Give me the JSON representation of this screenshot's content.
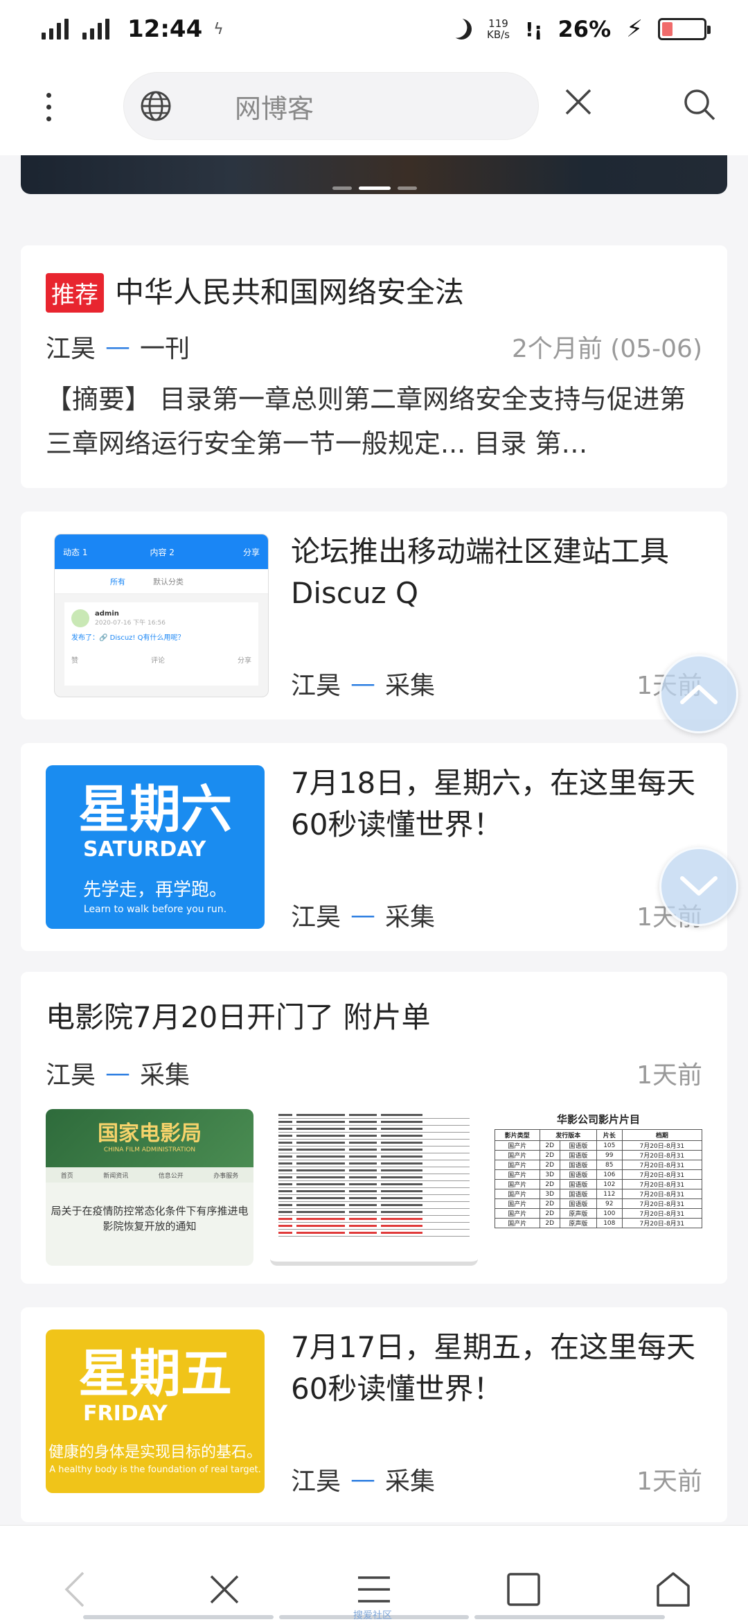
{
  "status_bar": {
    "time": "12:44",
    "net_speed_value": "119",
    "net_speed_unit": "KB/s",
    "signal_label": "!¡",
    "battery_pct": "26%",
    "battery_level": 0.26
  },
  "toolbar": {
    "url_text": "网博客"
  },
  "articles": [
    {
      "tag": "推荐",
      "title": "中华人民共和国网络安全法",
      "author": "江昊",
      "category": "一刊",
      "time": "2个月前 (05-06)",
      "excerpt": "【摘要】 目录第一章总则第二章网络安全支持与促进第三章网络运行安全第一节一般规定... 目录 第…"
    },
    {
      "title": "论坛推出移动端社区建站工具 Discuz Q",
      "author": "江昊",
      "category": "采集",
      "time": "1天前",
      "thumb": {
        "tab_a": "动态 1",
        "tab_b": "内容 2",
        "share": "分享",
        "sub_all": "所有",
        "sub_default": "默认分类",
        "user": "admin",
        "date": "2020-07-16 下午 16:56",
        "post": "发布了：🔗 Discuz! Q有什么用呢？",
        "like": "赞",
        "comment": "评论",
        "forward": "分享"
      }
    },
    {
      "title": "7月18日，星期六，在这里每天60秒读懂世界！",
      "author": "江昊",
      "category": "采集",
      "time": "1天前",
      "thumb": {
        "big": "星期六",
        "en": "SATURDAY",
        "slogan": "先学走，再学跑。",
        "slogan_en": "Learn to walk before you run.",
        "color": "#1a8cf0"
      }
    },
    {
      "title": "电影院7月20日开门了 附片单",
      "author": "江昊",
      "category": "采集",
      "time": "1天前",
      "images": {
        "img1_title": "国家电影局",
        "img1_en": "CHINA FILM ADMINISTRATION",
        "img1_nav": [
          "首页",
          "新闻资讯",
          "信息公开",
          "办事服务"
        ],
        "img1_body": "局关于在疫情防控常态化条件下有序推进电影院恢复开放的通知",
        "img3_title": "华影公司影片片目",
        "img3_headers": [
          "影片类型",
          "发行版本",
          "片长",
          "档期"
        ],
        "img3_rows": [
          [
            "国产片",
            "2D",
            "国语版",
            "105",
            "7月20日-8月31"
          ],
          [
            "国产片",
            "2D",
            "国语版",
            "99",
            "7月20日-8月31"
          ],
          [
            "国产片",
            "2D",
            "国语版",
            "85",
            "7月20日-8月31"
          ],
          [
            "国产片",
            "3D",
            "国语版",
            "106",
            "7月20日-8月31"
          ],
          [
            "国产片",
            "2D",
            "国语版",
            "102",
            "7月20日-8月31"
          ],
          [
            "国产片",
            "3D",
            "国语版",
            "112",
            "7月20日-8月31"
          ],
          [
            "国产片",
            "2D",
            "国语版",
            "92",
            "7月20日-8月31"
          ],
          [
            "国产片",
            "2D",
            "原声版",
            "100",
            "7月20日-8月31"
          ],
          [
            "国产片",
            "2D",
            "原声版",
            "108",
            "7月20日-8月31"
          ]
        ]
      }
    },
    {
      "title": "7月17日，星期五，在这里每天60秒读懂世界！",
      "author": "江昊",
      "category": "采集",
      "time": "1天前",
      "thumb": {
        "big": "星期五",
        "en": "FRIDAY",
        "slogan": "健康的身体是实现目标的基石。",
        "slogan_en": "A healthy body is the foundation of real target.",
        "color": "#f0c419"
      }
    }
  ],
  "gesture_label": "搜爱社区"
}
